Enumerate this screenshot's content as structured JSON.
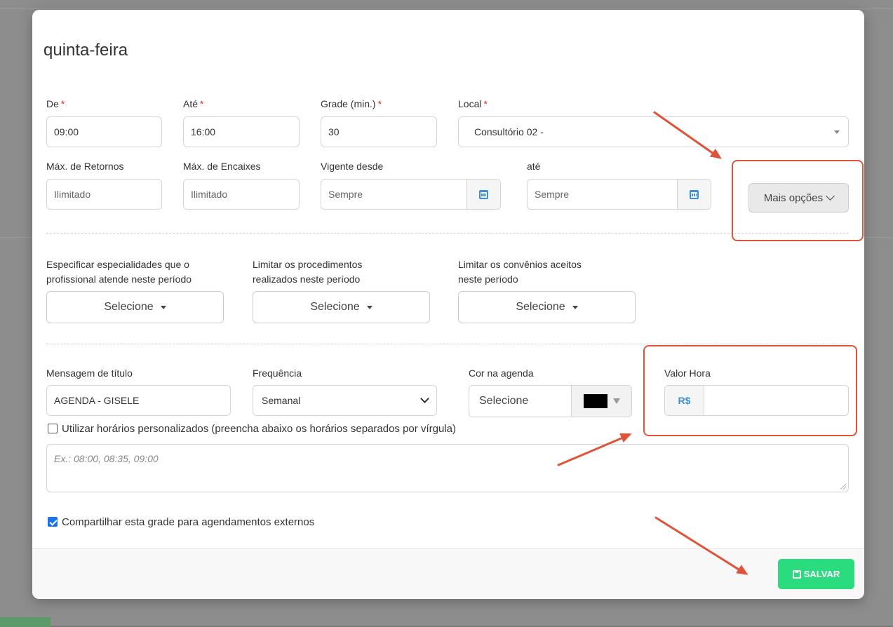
{
  "dialog": {
    "title": "quinta-feira"
  },
  "schedule": {
    "from": {
      "label": "De",
      "required": "*",
      "value": "09:00"
    },
    "to": {
      "label": "Até",
      "required": "*",
      "value": "16:00"
    },
    "grid": {
      "label": "Grade (min.)",
      "required": "*",
      "value": "30"
    },
    "location": {
      "label": "Local",
      "required": "*",
      "value": "Consultório 02 -"
    },
    "max_returns": {
      "label": "Máx. de Retornos",
      "placeholder": "Ilimitado"
    },
    "max_fits": {
      "label": "Máx. de Encaixes",
      "placeholder": "Ilimitado"
    },
    "valid_from": {
      "label": "Vigente desde",
      "placeholder": "Sempre"
    },
    "valid_to": {
      "label": "até",
      "placeholder": "Sempre"
    },
    "more_options": "Mais opções"
  },
  "filters": {
    "specialties": {
      "label_1": "Especificar especialidades que o",
      "label_2": "profissional atende neste período",
      "value": "Selecione"
    },
    "procedures": {
      "label_1": "Limitar os procedimentos",
      "label_2": "realizados neste período",
      "value": "Selecione"
    },
    "insurances": {
      "label_1": "Limitar os convênios aceitos",
      "label_2": "neste período",
      "value": "Selecione"
    }
  },
  "details": {
    "title_message": {
      "label": "Mensagem de título",
      "value": "AGENDA - GISELE"
    },
    "frequency": {
      "label": "Frequência",
      "value": "Semanal"
    },
    "color": {
      "label": "Cor na agenda",
      "value": "Selecione",
      "swatch": "#000000"
    },
    "hour_value": {
      "label": "Valor Hora",
      "currency": "R$",
      "value": ""
    }
  },
  "custom_times": {
    "checkbox_label": "Utilizar horários personalizados (preencha abaixo os horários separados por vírgula)",
    "checked": false,
    "placeholder": "Ex.: 08:00, 08:35, 09:00"
  },
  "share": {
    "checkbox_label": "Compartilhar esta grade para agendamentos externos",
    "checked": true
  },
  "footer": {
    "save_label": "SALVAR"
  },
  "colors": {
    "accent_annotation": "#e0533a",
    "save_button": "#2bdc7e",
    "required_star": "#e02b2b",
    "calendar_icon": "#3a8fd8",
    "currency_addon": "#3a8fd8"
  }
}
